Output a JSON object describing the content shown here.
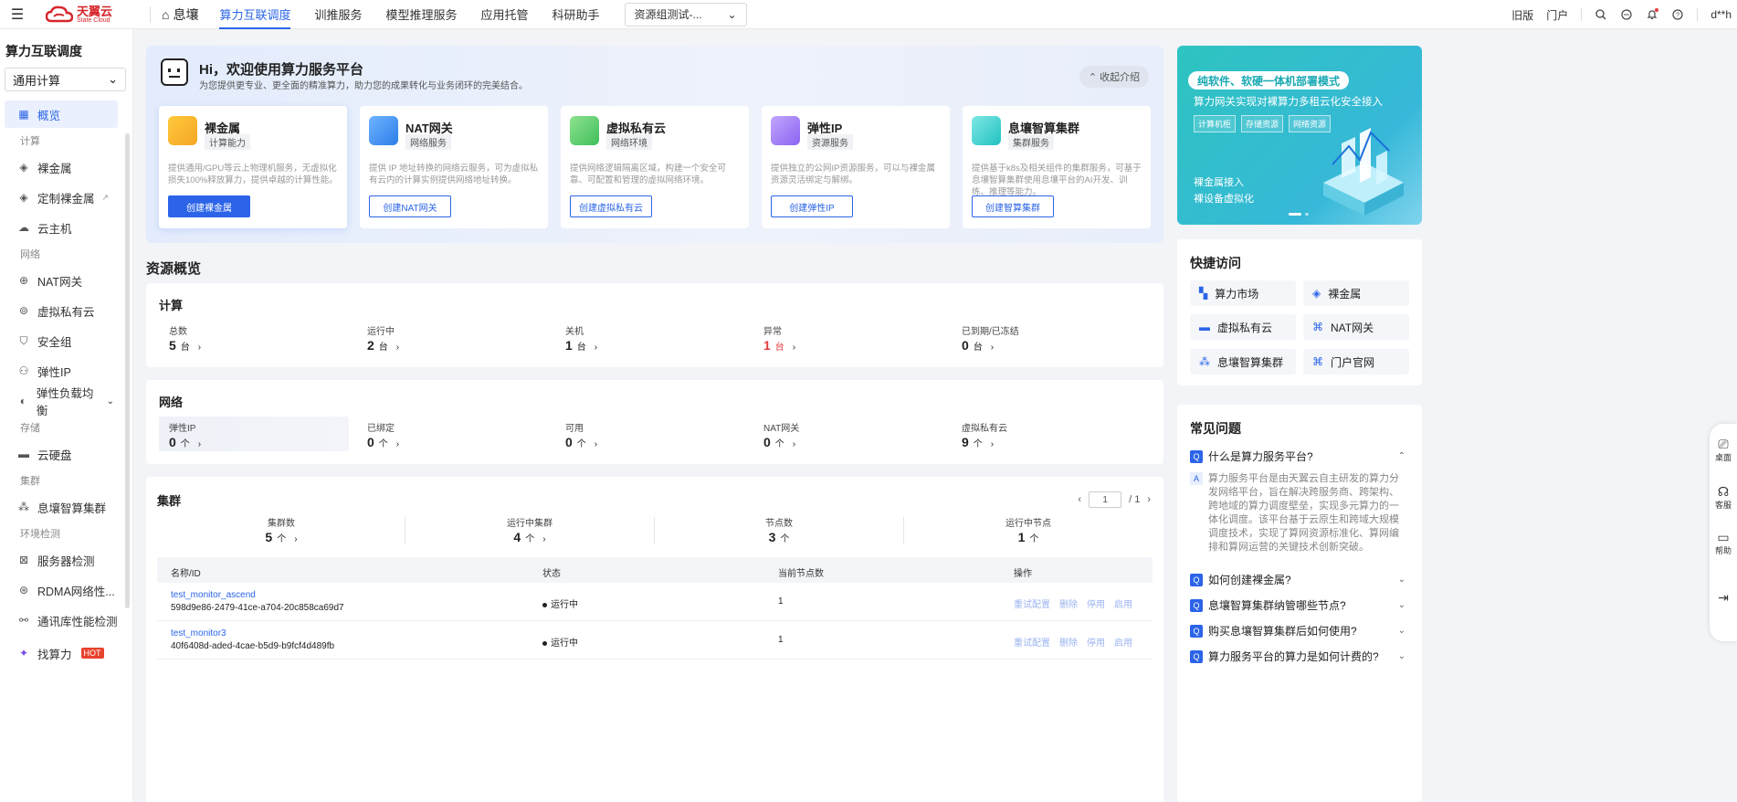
{
  "header": {
    "logo_cn": "天翼云",
    "logo_en": "State Cloud",
    "home": "息壤",
    "nav": [
      "算力互联调度",
      "训推服务",
      "模型推理服务",
      "应用托管",
      "科研助手"
    ],
    "resource_select": "资源组测试-...",
    "right": {
      "old": "旧版",
      "portal": "门户",
      "user": "d**h"
    }
  },
  "sidebar": {
    "title": "算力互联调度",
    "select": "通用计算",
    "overview": "概览",
    "groups": {
      "compute": "计算",
      "network": "网络",
      "storage": "存储",
      "cluster": "集群",
      "env": "环境检测"
    },
    "items": {
      "bare_metal": "裸金属",
      "custom_bare_metal": "定制裸金属",
      "cloud_host": "云主机",
      "nat": "NAT网关",
      "vpc": "虚拟私有云",
      "security_group": "安全组",
      "eip": "弹性IP",
      "elb": "弹性负载均衡",
      "disk": "云硬盘",
      "ai_cluster": "息壤智算集群",
      "server_check": "服务器检测",
      "rdma_check": "RDMA网络性...",
      "comm_check": "通讯库性能检测",
      "find_power": "找算力",
      "hot": "HOT"
    }
  },
  "welcome": {
    "title": "Hi，欢迎使用算力服务平台",
    "subtitle": "为您提供更专业、更全面的精准算力，助力您的成果转化与业务闭环的完美结合。",
    "collapse": "收起介绍",
    "cards": [
      {
        "name": "裸金属",
        "tag": "计算能力",
        "desc": "提供通用/GPU等云上物理机服务，无虚拟化损失100%释放算力，提供卓越的计算性能。",
        "button": "创建裸金属"
      },
      {
        "name": "NAT网关",
        "tag": "网络服务",
        "desc": "提供 IP 地址转换的网络云服务，可为虚拟私有云内的计算实例提供网络地址转换。",
        "button": "创建NAT网关"
      },
      {
        "name": "虚拟私有云",
        "tag": "网络环境",
        "desc": "提供网络逻辑隔离区域，构建一个安全可靠、可配置和管理的虚拟网络环境。",
        "button": "创建虚拟私有云"
      },
      {
        "name": "弹性IP",
        "tag": "资源服务",
        "desc": "提供独立的公网IP资源服务，可以与裸金属资源灵活绑定与解绑。",
        "button": "创建弹性IP"
      },
      {
        "name": "息壤智算集群",
        "tag": "集群服务",
        "desc": "提供基于k8s及相关组件的集群服务，可基于息壤智算集群使用息壤平台的AI开发、训练、推理等能力。",
        "button": "创建智算集群"
      }
    ]
  },
  "banner": {
    "title": "纯软件、软硬一体机部署模式",
    "subtitle": "算力网关实现对裸算力多租云化安全接入",
    "tags": [
      "计算机柜",
      "存储资源",
      "网络资源"
    ],
    "line1": "裸金属接入",
    "line2": "裸设备虚拟化"
  },
  "overview": {
    "title": "资源概览",
    "compute": {
      "title": "计算",
      "stats": [
        {
          "label": "总数",
          "value": "5",
          "unit": "台"
        },
        {
          "label": "运行中",
          "value": "2",
          "unit": "台"
        },
        {
          "label": "关机",
          "value": "1",
          "unit": "台"
        },
        {
          "label": "异常",
          "value": "1",
          "unit": "台"
        },
        {
          "label": "已到期/已冻结",
          "value": "0",
          "unit": "台"
        }
      ]
    },
    "network": {
      "title": "网络",
      "stats": [
        {
          "label": "弹性IP",
          "value": "0",
          "unit": "个"
        },
        {
          "label": "已绑定",
          "value": "0",
          "unit": "个"
        },
        {
          "label": "可用",
          "value": "0",
          "unit": "个"
        },
        {
          "label": "NAT网关",
          "value": "0",
          "unit": "个"
        },
        {
          "label": "虚拟私有云",
          "value": "9",
          "unit": "个"
        }
      ]
    },
    "cluster": {
      "title": "集群",
      "page": "1",
      "total": "/ 1",
      "stats": [
        {
          "label": "集群数",
          "value": "5",
          "unit": "个"
        },
        {
          "label": "运行中集群",
          "value": "4",
          "unit": "个"
        },
        {
          "label": "节点数",
          "value": "3",
          "unit": "个"
        },
        {
          "label": "运行中节点",
          "value": "1",
          "unit": "个"
        }
      ],
      "columns": [
        "名称/ID",
        "状态",
        "当前节点数",
        "操作"
      ],
      "rows": [
        {
          "name": "test_monitor_ascend",
          "id": "598d9e86-2479-41ce-a704-20c858ca69d7",
          "status": "运行中",
          "nodes": "1"
        },
        {
          "name": "test_monitor3",
          "id": "40f6408d-aded-4cae-b5d9-b9fcf4d489fb",
          "status": "运行中",
          "nodes": "1"
        }
      ],
      "ops": [
        "重试配置",
        "删除",
        "停用",
        "启用"
      ]
    }
  },
  "quick": {
    "title": "快捷访问",
    "items": [
      "算力市场",
      "裸金属",
      "虚拟私有云",
      "NAT网关",
      "息壤智算集群",
      "门户官网"
    ]
  },
  "faq": {
    "title": "常见问题",
    "q1": "什么是算力服务平台?",
    "a1": "算力服务平台是由天翼云自主研发的算力分发网络平台，旨在解决跨服务商、跨架构、跨地域的算力调度壁垒，实现多元算力的一体化调度。该平台基于云原生和跨域大规模调度技术，实现了算网资源标准化、算网编排和算网运营的关键技术创新突破。",
    "q2": "如何创建裸金属?",
    "q3": "息壤智算集群纳管哪些节点?",
    "q4": "购买息壤智算集群后如何使用?",
    "q5": "算力服务平台的算力是如何计费的?",
    "q_badge": "Q",
    "a_badge": "A"
  },
  "float": {
    "desktop": "桌面",
    "service": "客服",
    "help": "帮助"
  }
}
